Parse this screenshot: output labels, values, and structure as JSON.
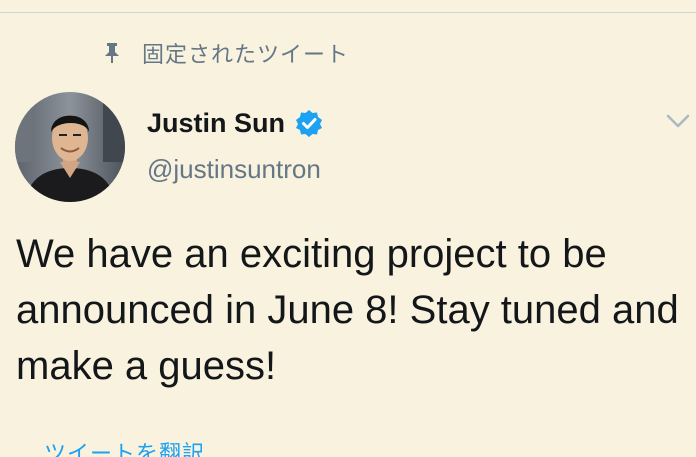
{
  "pinned": {
    "label": "固定されたツイート",
    "icon": "pin-icon"
  },
  "author": {
    "name": "Justin Sun",
    "handle": "@justinsuntron",
    "verified": true,
    "verified_icon": "verified-badge-icon",
    "avatar_icon": "avatar-photo"
  },
  "tweet": {
    "text": "We have an exciting project to be announced in June 8! Stay tuned and make a guess!"
  },
  "actions": {
    "menu_icon": "chevron-down-icon",
    "translate_label": "ツイートを翻訳"
  },
  "colors": {
    "background": "#f8f2de",
    "text": "#14171a",
    "secondary": "#657786",
    "accent": "#1da1f2"
  }
}
